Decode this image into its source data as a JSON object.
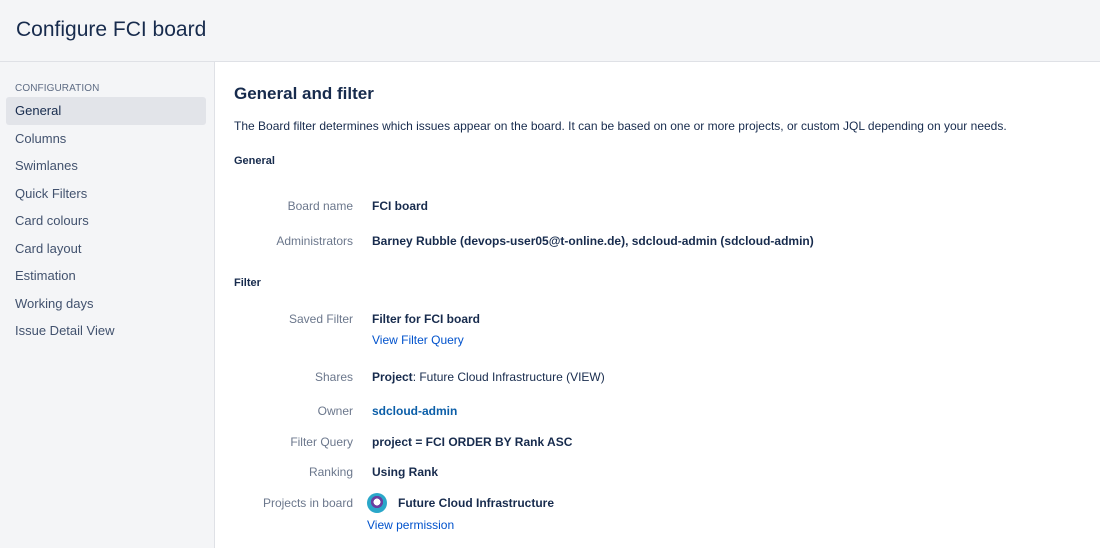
{
  "header": {
    "title": "Configure FCI board"
  },
  "sidebar": {
    "section_label": "CONFIGURATION",
    "items": [
      {
        "label": "General"
      },
      {
        "label": "Columns"
      },
      {
        "label": "Swimlanes"
      },
      {
        "label": "Quick Filters"
      },
      {
        "label": "Card colours"
      },
      {
        "label": "Card layout"
      },
      {
        "label": "Estimation"
      },
      {
        "label": "Working days"
      },
      {
        "label": "Issue Detail View"
      }
    ],
    "active_item": "General"
  },
  "main": {
    "title": "General and filter",
    "description": "The Board filter determines which issues appear on the board. It can be based on one or more projects, or custom JQL depending on your needs.",
    "general": {
      "heading": "General",
      "board_name_label": "Board name",
      "board_name_value": "FCI board",
      "administrators_label": "Administrators",
      "administrators_value": "Barney Rubble (devops-user05@t-online.de), sdcloud-admin (sdcloud-admin)"
    },
    "filter": {
      "heading": "Filter",
      "saved_filter_label": "Saved Filter",
      "saved_filter_value": "Filter for FCI board",
      "view_filter_query": "View Filter Query",
      "shares_label": "Shares",
      "shares_prefix": "Project",
      "shares_value": ": Future Cloud Infrastructure (VIEW)",
      "owner_label": "Owner",
      "owner_value": "sdcloud-admin",
      "filter_query_label": "Filter Query",
      "filter_query_value": "project = FCI ORDER BY Rank ASC",
      "ranking_label": "Ranking",
      "ranking_value": "Using Rank",
      "projects_label": "Projects in board",
      "project_name": "Future Cloud Infrastructure",
      "view_permission": "View permission"
    }
  },
  "colors": {
    "link": "#0052cc",
    "sidebar_bg": "#f4f5f7",
    "active_item_bg": "#e2e4e9",
    "text": "#172b4d",
    "label": "#6b778c"
  }
}
